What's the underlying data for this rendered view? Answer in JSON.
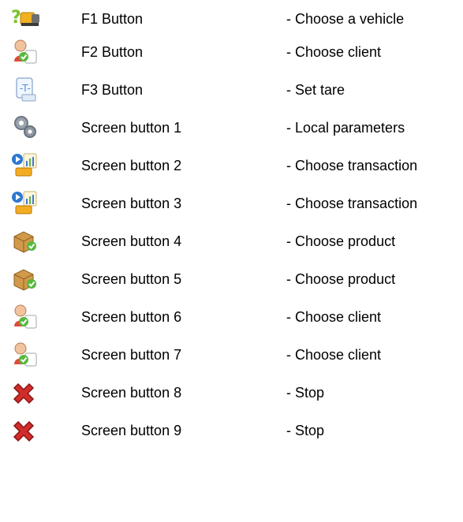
{
  "rows": [
    {
      "icon": "vehicle-question-icon",
      "label": "F1 Button",
      "description": "- Choose a vehicle"
    },
    {
      "icon": "client-icon",
      "label": "F2 Button",
      "description": "- Choose client"
    },
    {
      "icon": "tare-icon",
      "label": "F3 Button",
      "description": "- Set tare"
    },
    {
      "icon": "gears-icon",
      "label": "Screen button 1",
      "description": "- Local parameters"
    },
    {
      "icon": "transaction-icon",
      "label": "Screen button 2",
      "description": "- Choose transaction"
    },
    {
      "icon": "transaction-icon",
      "label": "Screen button 3",
      "description": "- Choose transaction"
    },
    {
      "icon": "product-icon",
      "label": "Screen button 4",
      "description": "- Choose product"
    },
    {
      "icon": "product-icon",
      "label": "Screen button 5",
      "description": "- Choose product"
    },
    {
      "icon": "client-icon",
      "label": "Screen button 6",
      "description": "- Choose client"
    },
    {
      "icon": "client-icon",
      "label": "Screen button 7",
      "description": "- Choose client"
    },
    {
      "icon": "stop-icon",
      "label": "Screen button 8",
      "description": "- Stop"
    },
    {
      "icon": "stop-icon",
      "label": "Screen button 9",
      "description": "- Stop"
    }
  ]
}
